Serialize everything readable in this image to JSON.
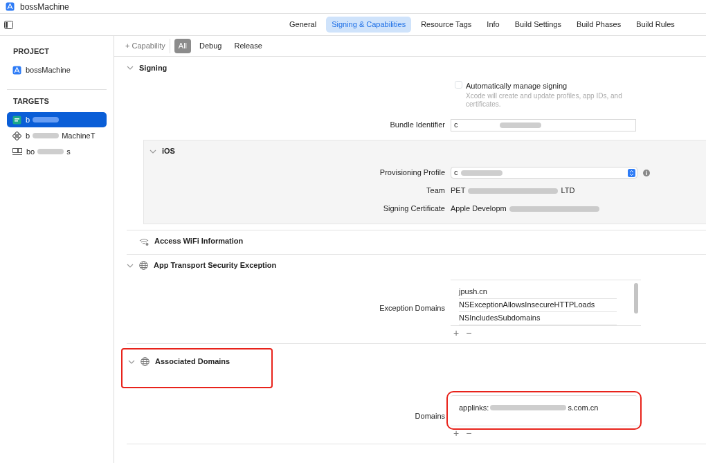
{
  "window": {
    "title": "bossMachine"
  },
  "tabs": [
    {
      "label": "General",
      "selected": false
    },
    {
      "label": "Signing & Capabilities",
      "selected": true
    },
    {
      "label": "Resource Tags",
      "selected": false
    },
    {
      "label": "Info",
      "selected": false
    },
    {
      "label": "Build Settings",
      "selected": false
    },
    {
      "label": "Build Phases",
      "selected": false
    },
    {
      "label": "Build Rules",
      "selected": false
    }
  ],
  "sidebar": {
    "groups": [
      {
        "title": "PROJECT",
        "items": [
          {
            "kind": "project",
            "label": "bossMachine",
            "selected": false
          }
        ]
      },
      {
        "title": "TARGETS",
        "items": [
          {
            "kind": "app",
            "label": "b",
            "selected": true
          },
          {
            "kind": "test",
            "label": "b",
            "label_end": "MachineT",
            "selected": false
          },
          {
            "kind": "uitest",
            "label": "bo",
            "label_end": "s",
            "selected": false
          }
        ]
      }
    ]
  },
  "toolbar": {
    "add_label": "+ Capability",
    "filters": [
      {
        "label": "All",
        "selected": true
      },
      {
        "label": "Debug",
        "selected": false
      },
      {
        "label": "Release",
        "selected": false
      }
    ]
  },
  "sections": [
    {
      "kind": "signing",
      "title": "Signing",
      "expanded": true,
      "auto_manage": {
        "label": "Automatically manage signing",
        "checked": false,
        "hint": "Xcode will create and update profiles, app IDs, and certificates."
      },
      "bundle": {
        "label": "Bundle Identifier",
        "value": "c"
      },
      "platform": {
        "title": "iOS",
        "expanded": true,
        "rows": [
          {
            "kind": "popup",
            "label": "Provisioning Profile",
            "value": "c"
          },
          {
            "kind": "text",
            "label": "Team",
            "value": "PET",
            "value_end": "LTD"
          },
          {
            "kind": "text",
            "label": "Signing Certificate",
            "value": "Apple Developm"
          }
        ]
      }
    },
    {
      "kind": "wifi",
      "title": "Access WiFi Information"
    },
    {
      "kind": "ats",
      "title": "App Transport Security Exception",
      "expanded": true,
      "list": {
        "label": "Exception Domains",
        "items": [
          {
            "value": "jpush.cn"
          },
          {
            "value": "NSExceptionAllowsInsecureHTTPLoads"
          },
          {
            "value": "NSIncludesSubdomains"
          }
        ],
        "add": "+",
        "remove": "−"
      }
    },
    {
      "kind": "domains",
      "title": "Associated Domains",
      "expanded": true,
      "highlighted": true,
      "list": {
        "label": "Domains",
        "highlighted": true,
        "items": [
          {
            "value": "applinks:",
            "value_end": "s.com.cn"
          }
        ],
        "add": "+",
        "remove": "−"
      }
    }
  ]
}
